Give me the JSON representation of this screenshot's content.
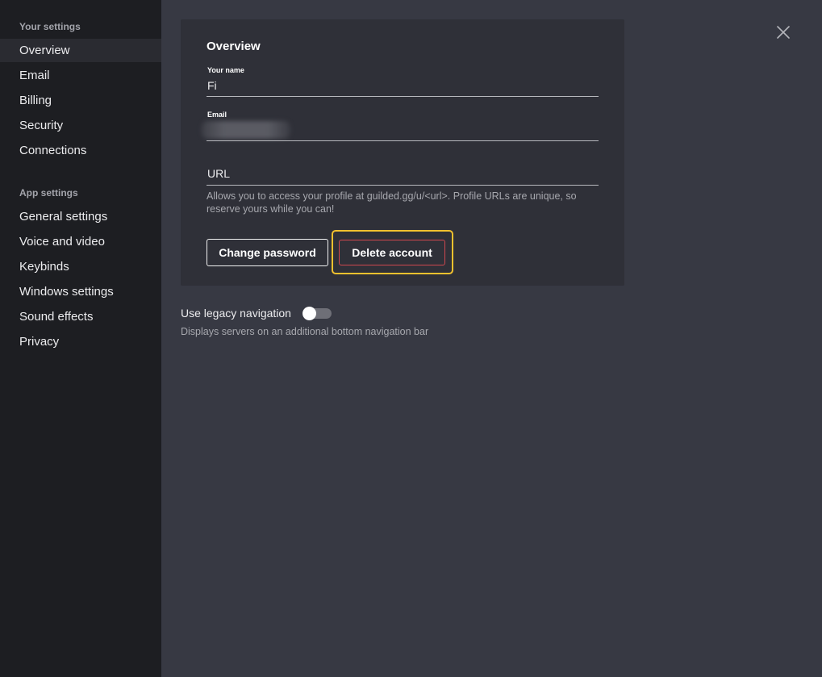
{
  "sidebar": {
    "your_settings_header": "Your settings",
    "your_settings_items": [
      {
        "label": "Overview",
        "active": true
      },
      {
        "label": "Email"
      },
      {
        "label": "Billing"
      },
      {
        "label": "Security"
      },
      {
        "label": "Connections"
      }
    ],
    "app_settings_header": "App settings",
    "app_settings_items": [
      {
        "label": "General settings"
      },
      {
        "label": "Voice and video"
      },
      {
        "label": "Keybinds"
      },
      {
        "label": "Windows settings"
      },
      {
        "label": "Sound effects"
      },
      {
        "label": "Privacy"
      }
    ]
  },
  "overview": {
    "title": "Overview",
    "name_label": "Your name",
    "name_value": "Fi",
    "email_label": "Email",
    "url_placeholder": "URL",
    "url_hint": "Allows you to access your profile at guilded.gg/u/<url>. Profile URLs are unique, so reserve yours while you can!",
    "change_password_label": "Change password",
    "delete_account_label": "Delete account"
  },
  "legacy": {
    "label": "Use legacy navigation",
    "description": "Displays servers on an additional bottom navigation bar",
    "enabled": false
  },
  "icons": {
    "close": "close-icon"
  },
  "colors": {
    "focus_ring": "#f2c12e",
    "delete_border": "#d0484f",
    "sidebar_bg": "#1d1e22",
    "main_bg": "#373943",
    "card_bg": "#2f3038"
  }
}
